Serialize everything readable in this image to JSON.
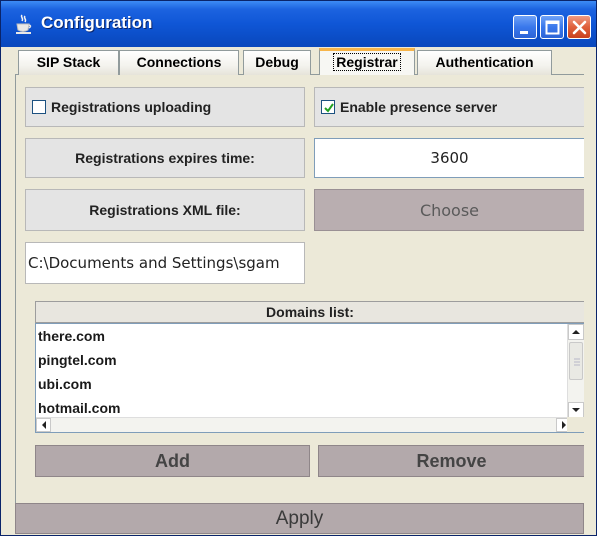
{
  "window": {
    "title": "Configuration",
    "icon": "java-cup-icon",
    "controls": [
      "minimize-icon",
      "maximize-icon",
      "close-icon"
    ]
  },
  "tabs": [
    {
      "label": "SIP Stack",
      "active": false
    },
    {
      "label": "Connections",
      "active": false
    },
    {
      "label": "Debug",
      "active": false
    },
    {
      "label": "Registrar",
      "active": true
    },
    {
      "label": "Authentication",
      "active": false
    }
  ],
  "registrar": {
    "registrations_uploading": {
      "label": "Registrations uploading",
      "checked": false
    },
    "enable_presence": {
      "label": "Enable presence server",
      "checked": true
    },
    "expires_label": "Registrations expires time:",
    "expires_value": "3600",
    "xml_label": "Registrations XML file:",
    "choose_label": "Choose",
    "path_value": "C:\\Documents and Settings\\sgam",
    "domains_header": "Domains list:",
    "domains": [
      "there.com",
      "pingtel.com",
      "ubi.com",
      "hotmail.com"
    ],
    "add_label": "Add",
    "remove_label": "Remove"
  },
  "footer": {
    "apply_label": "Apply"
  },
  "colors": {
    "titlebar": "#0b4dc6",
    "tab_highlight": "#f7b54a",
    "window_bg": "#ece9d8"
  }
}
